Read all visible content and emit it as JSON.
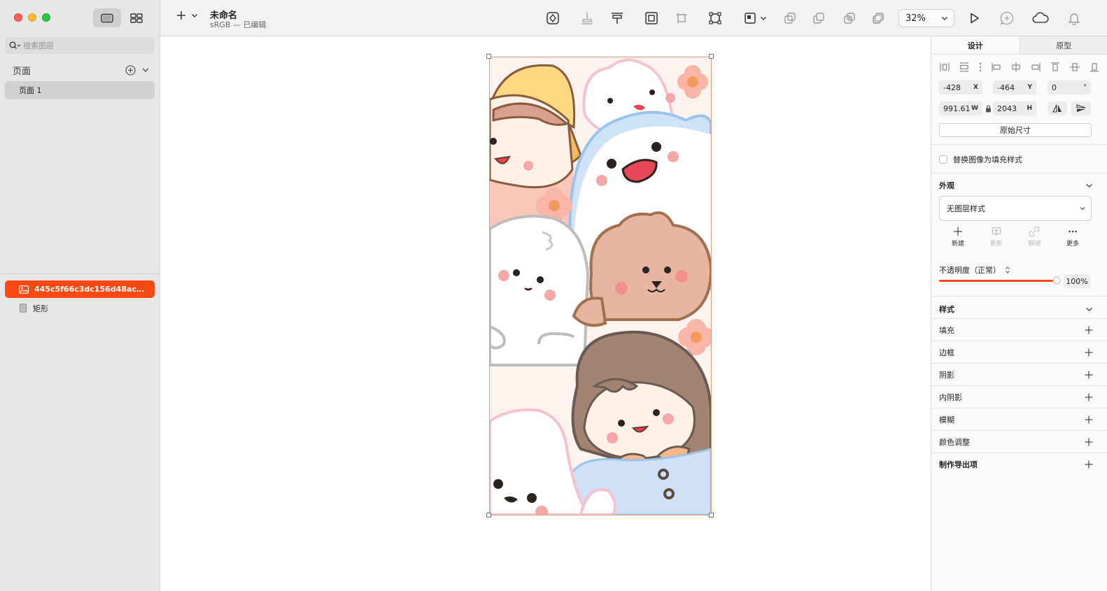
{
  "sidebar": {
    "search_placeholder": "搜索图层",
    "pages_label": "页面",
    "pages": [
      {
        "label": "页面 1"
      }
    ],
    "layers": [
      {
        "label": "445c5f66c3dc156d48ac58b...",
        "selected": true
      },
      {
        "label": "矩形",
        "selected": false
      }
    ]
  },
  "toolbar": {
    "doc_title": "未命名",
    "doc_subtitle": "sRGB — 已编辑",
    "zoom": "32%"
  },
  "inspector": {
    "tabs": [
      {
        "label": "设计"
      },
      {
        "label": "原型"
      }
    ],
    "x": {
      "value": "-428",
      "suffix": "X"
    },
    "y": {
      "value": "-464",
      "suffix": "Y"
    },
    "rotation": {
      "value": "0",
      "suffix": "°"
    },
    "w": {
      "value": "991.61",
      "suffix": "W"
    },
    "h": {
      "value": "2043",
      "suffix": "H"
    },
    "original_size_label": "原始尺寸",
    "replace_fill_label": "替换图像为填充样式",
    "appearance": {
      "title": "外观",
      "style_value": "无图层样式",
      "actions": [
        {
          "label": "新建",
          "enabled": true
        },
        {
          "label": "更新",
          "enabled": false
        },
        {
          "label": "解绑",
          "enabled": false
        },
        {
          "label": "更多",
          "enabled": true
        }
      ]
    },
    "opacity": {
      "label": "不透明度（正常）",
      "value": "100%"
    },
    "style_section": {
      "title": "样式"
    },
    "properties": [
      {
        "label": "填充"
      },
      {
        "label": "边框"
      },
      {
        "label": "阴影"
      },
      {
        "label": "内阴影"
      },
      {
        "label": "模糊"
      },
      {
        "label": "颜色调整"
      }
    ],
    "export_title": "制作导出项"
  },
  "colors": {
    "accent": "#fe4a12",
    "sidebar_bg": "#e7e7e7",
    "canvas_bg": "#ffffff"
  }
}
